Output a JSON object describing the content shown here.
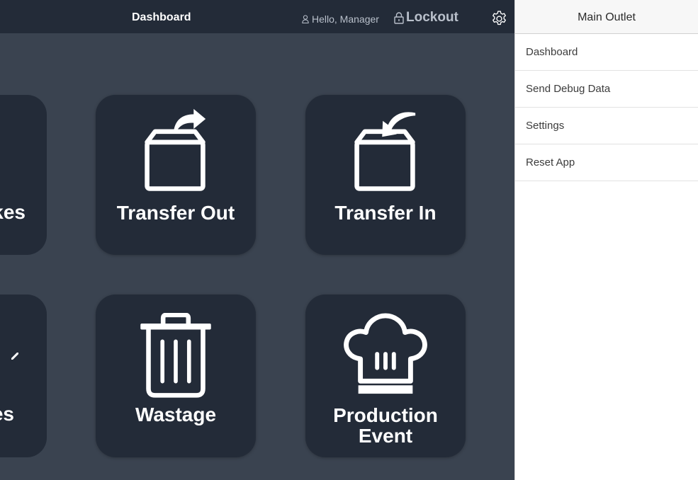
{
  "header": {
    "title": "Dashboard",
    "greeting": "Hello, Manager",
    "lockout_label": "Lockout",
    "icons": [
      "user-icon",
      "lock-icon",
      "gear-icon"
    ]
  },
  "tiles": {
    "partial_top": "kes",
    "transfer_out": "Transfer Out",
    "transfer_in": "Transfer In",
    "partial_bottom": "es",
    "wastage": "Wastage",
    "production_line1": "Production",
    "production_line2": "Event"
  },
  "side_panel": {
    "title": "Main Outlet",
    "items": [
      {
        "label": "Dashboard"
      },
      {
        "label": "Send Debug Data"
      },
      {
        "label": "Settings"
      },
      {
        "label": "Reset App"
      }
    ]
  },
  "colors": {
    "background": "#3a4350",
    "tile": "#232b38",
    "topbar": "#232b38",
    "panel": "#ffffff"
  }
}
